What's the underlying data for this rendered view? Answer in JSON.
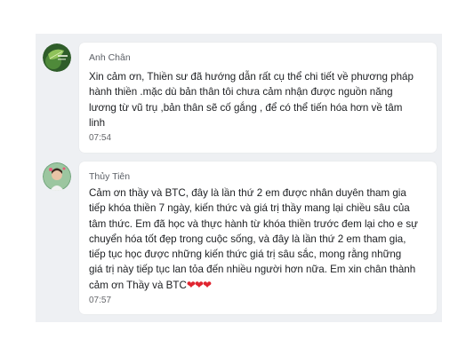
{
  "comments": [
    {
      "author": "Anh Chân",
      "text": "Xin cảm ơn, Thiền sư đã hướng dẫn rất cụ thể chi tiết về phương pháp\nhành thiền .mặc dù bản thân tôi chưa cảm nhận được nguồn năng\nlương từ vũ trụ ,bản thân sẽ cố gắng , để có thể tiến hóa hơn về tâm\nlinh",
      "time": "07:54",
      "avatar_icon": "leaf-avatar-icon"
    },
    {
      "author": "Thủy Tiên",
      "text": "Cảm ơn thầy và BTC, đây là lần thứ 2 em được nhân duyên tham gia\ntiếp khóa thiền 7 ngày, kiến thức và giá trị thầy mang lại chiều sâu của\ntâm thức. Em đã học và thực hành từ khóa thiền trước đem lại cho e sự\nchuyển hóa tốt đẹp trong cuộc sống, và đây là lần thứ 2 em tham gia,\ntiếp tục học được những kiến thức giá trị sâu sắc, mong rằng những\ngiá trị này tiếp tục lan tỏa đến nhiều người hơn nữa. Em xin chân thành\ncảm ơn Thầy và BTC",
      "emoji": "❤❤❤",
      "time": "07:57",
      "avatar_icon": "person-avatar-icon"
    }
  ],
  "colors": {
    "panel_bg": "#eef0f3",
    "bubble_bg": "#ffffff",
    "heart": "#e0242f"
  }
}
